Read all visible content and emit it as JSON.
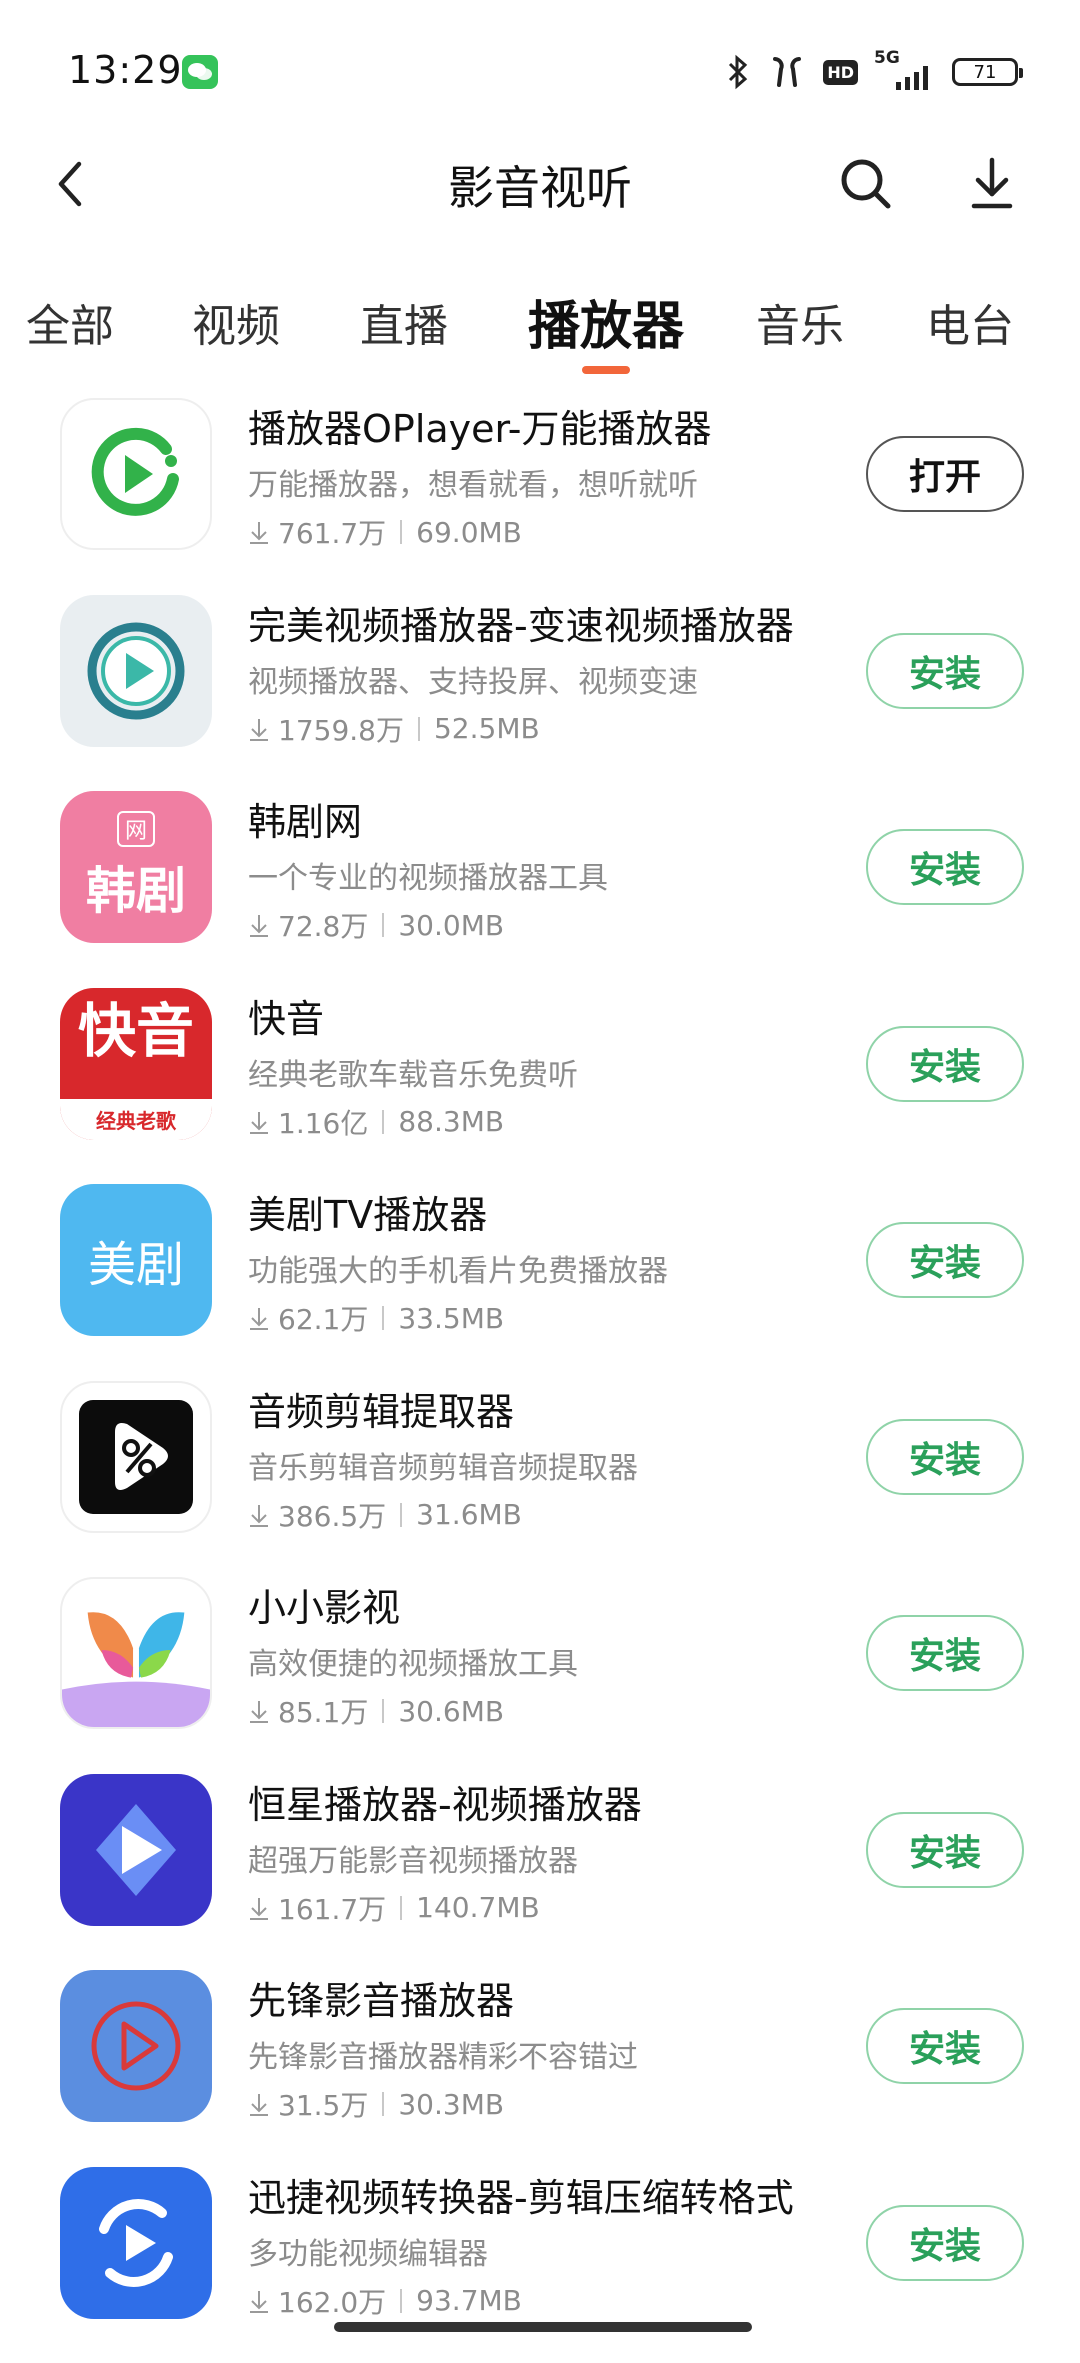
{
  "status": {
    "time": "13:29",
    "network": "5G",
    "hd": "HD",
    "battery": "71"
  },
  "header": {
    "title": "影音视听"
  },
  "tabs": [
    {
      "label": "全部"
    },
    {
      "label": "视频"
    },
    {
      "label": "直播"
    },
    {
      "label": "播放器"
    },
    {
      "label": "音乐"
    },
    {
      "label": "电台"
    }
  ],
  "apps": [
    {
      "name": "播放器OPlayer-万能播放器",
      "desc": "万能播放器，想看就看，想听就听",
      "downloads": "761.7万",
      "size": "69.0MB",
      "action": "打开"
    },
    {
      "name": "完美视频播放器-变速视频播放器",
      "desc": "视频播放器、支持投屏、视频变速",
      "downloads": "1759.8万",
      "size": "52.5MB",
      "action": "安装"
    },
    {
      "name": "韩剧网",
      "desc": "一个专业的视频播放器工具",
      "downloads": "72.8万",
      "size": "30.0MB",
      "action": "安装",
      "icon_text": "韩剧",
      "icon_sub": "网"
    },
    {
      "name": "快音",
      "desc": "经典老歌车载音乐免费听",
      "downloads": "1.16亿",
      "size": "88.3MB",
      "action": "安装",
      "icon_text": "快音",
      "icon_sub": "经典老歌"
    },
    {
      "name": "美剧TV播放器",
      "desc": "功能强大的手机看片免费播放器",
      "downloads": "62.1万",
      "size": "33.5MB",
      "action": "安装",
      "icon_text": "美剧"
    },
    {
      "name": "音频剪辑提取器",
      "desc": "音乐剪辑音频剪辑音频提取器",
      "downloads": "386.5万",
      "size": "31.6MB",
      "action": "安装"
    },
    {
      "name": "小小影视",
      "desc": "高效便捷的视频播放工具",
      "downloads": "85.1万",
      "size": "30.6MB",
      "action": "安装"
    },
    {
      "name": "恒星播放器-视频播放器",
      "desc": "超强万能影音视频播放器",
      "downloads": "161.7万",
      "size": "140.7MB",
      "action": "安装"
    },
    {
      "name": "先锋影音播放器",
      "desc": "先锋影音播放器精彩不容错过",
      "downloads": "31.5万",
      "size": "30.3MB",
      "action": "安装"
    },
    {
      "name": "迅捷视频转换器-剪辑压缩转格式",
      "desc": "多功能视频编辑器",
      "downloads": "162.0万",
      "size": "93.7MB",
      "action": "安装"
    }
  ],
  "colors": {
    "accent": "#f2663a",
    "install_text": "#2aa05a",
    "install_border": "#8fd3a8"
  }
}
